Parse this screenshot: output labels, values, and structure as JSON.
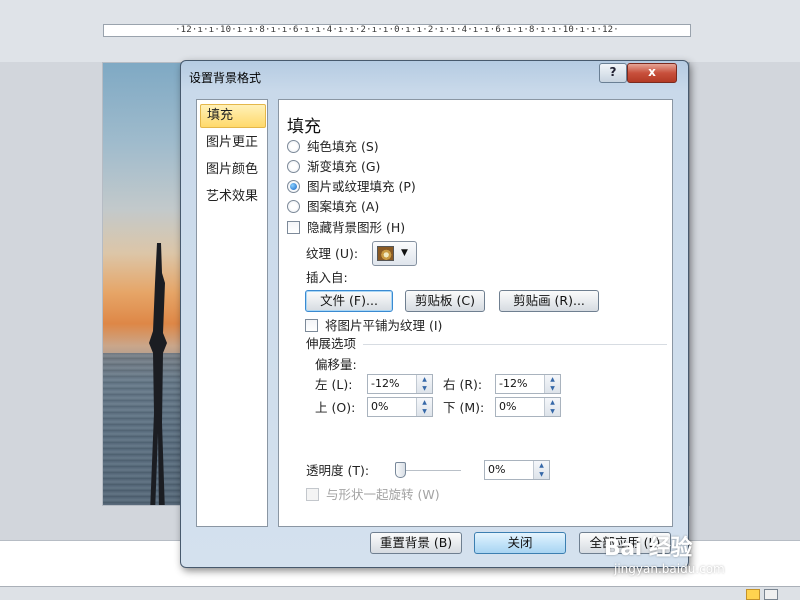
{
  "background_app": {
    "ruler_text": "·12·ı·ı·10·ı·ı·8·ı·ı·6·ı·ı·4·ı·ı·2·ı·ı·0·ı·ı·2·ı·ı·4·ı·ı·6·ı·ı·8·ı·ı·10·ı·ı·12·",
    "view_buttons": [
      "normal-view-icon",
      "slide-sorter-icon"
    ]
  },
  "dialog": {
    "title": "设置背景格式",
    "help_label": "?",
    "close_label": "x",
    "nav": {
      "items": [
        {
          "label": "填充",
          "selected": true
        },
        {
          "label": "图片更正",
          "selected": false
        },
        {
          "label": "图片颜色",
          "selected": false
        },
        {
          "label": "艺术效果",
          "selected": false
        }
      ]
    },
    "fill": {
      "title": "填充",
      "options": [
        {
          "label": "纯色填充 (S)",
          "selected": false
        },
        {
          "label": "渐变填充 (G)",
          "selected": false
        },
        {
          "label": "图片或纹理填充 (P)",
          "selected": true
        },
        {
          "label": "图案填充 (A)",
          "selected": false
        }
      ],
      "hide_bg_graphics": {
        "label": "隐藏背景图形 (H)",
        "checked": false
      },
      "texture_label": "纹理 (U):",
      "texture_icon": "wood-texture-icon",
      "insert_from_label": "插入自:",
      "insert_buttons": {
        "file": "文件 (F)...",
        "clipboard": "剪贴板 (C)",
        "clipart": "剪贴画 (R)..."
      },
      "tile_picture": {
        "label": "将图片平铺为纹理 (I)",
        "checked": false
      },
      "stretch_title": "伸展选项",
      "offsets_label": "偏移量:",
      "offsets": {
        "left": {
          "label": "左 (L):",
          "value": "-12%"
        },
        "right": {
          "label": "右 (R):",
          "value": "-12%"
        },
        "top": {
          "label": "上 (O):",
          "value": "0%"
        },
        "bottom": {
          "label": "下 (M):",
          "value": "0%"
        }
      },
      "transparency": {
        "label": "透明度 (T):",
        "value": "0%",
        "fraction": 0.0
      },
      "rotate_with_shape": {
        "label": "与形状一起旋转 (W)",
        "checked": false,
        "disabled": true
      }
    },
    "footer": {
      "reset": "重置背景 (B)",
      "close": "关闭",
      "apply_all": "全部应用 (L)"
    }
  },
  "watermark": {
    "main": "Bai 经验",
    "url": "jingyan.baidu.com"
  }
}
